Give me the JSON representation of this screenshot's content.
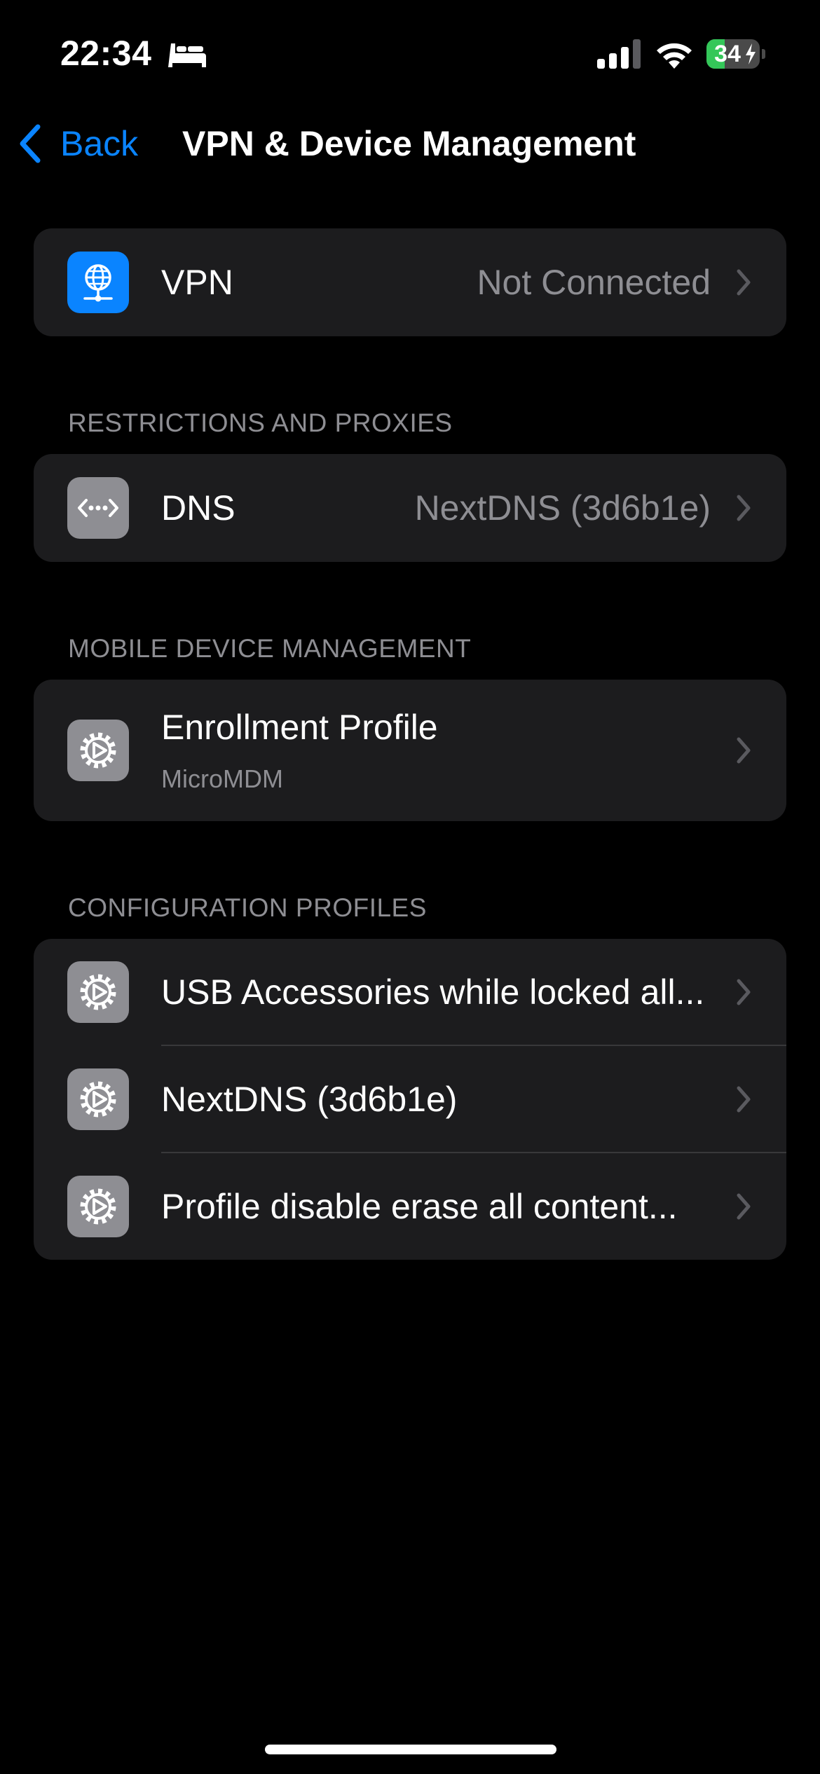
{
  "status_bar": {
    "time": "22:34",
    "battery_percent": "34",
    "battery_level": 0.34,
    "icons": [
      "bed-icon",
      "cellular-signal-icon",
      "wifi-icon",
      "battery-charging-icon"
    ]
  },
  "nav": {
    "back_label": "Back",
    "title": "VPN & Device Management"
  },
  "vpn_group": {
    "row": {
      "icon": "vpn-globe-icon",
      "title": "VPN",
      "value": "Not Connected"
    }
  },
  "restrictions": {
    "header": "RESTRICTIONS AND PROXIES",
    "row": {
      "icon": "dns-icon",
      "title": "DNS",
      "value": "NextDNS (3d6b1e)"
    }
  },
  "mdm": {
    "header": "MOBILE DEVICE MANAGEMENT",
    "row": {
      "icon": "settings-gear-icon",
      "title": "Enrollment Profile",
      "subtitle": "MicroMDM"
    }
  },
  "config_profiles": {
    "header": "CONFIGURATION PROFILES",
    "rows": [
      {
        "icon": "settings-gear-icon",
        "title": "USB Accessories while locked all..."
      },
      {
        "icon": "settings-gear-icon",
        "title": "NextDNS (3d6b1e)"
      },
      {
        "icon": "settings-gear-icon",
        "title": "Profile disable erase all content..."
      }
    ]
  },
  "colors": {
    "background": "#000000",
    "group_background": "#1c1c1e",
    "accent": "#0a84ff",
    "secondary_text": "#8e8e93",
    "battery_green": "#34c759"
  }
}
